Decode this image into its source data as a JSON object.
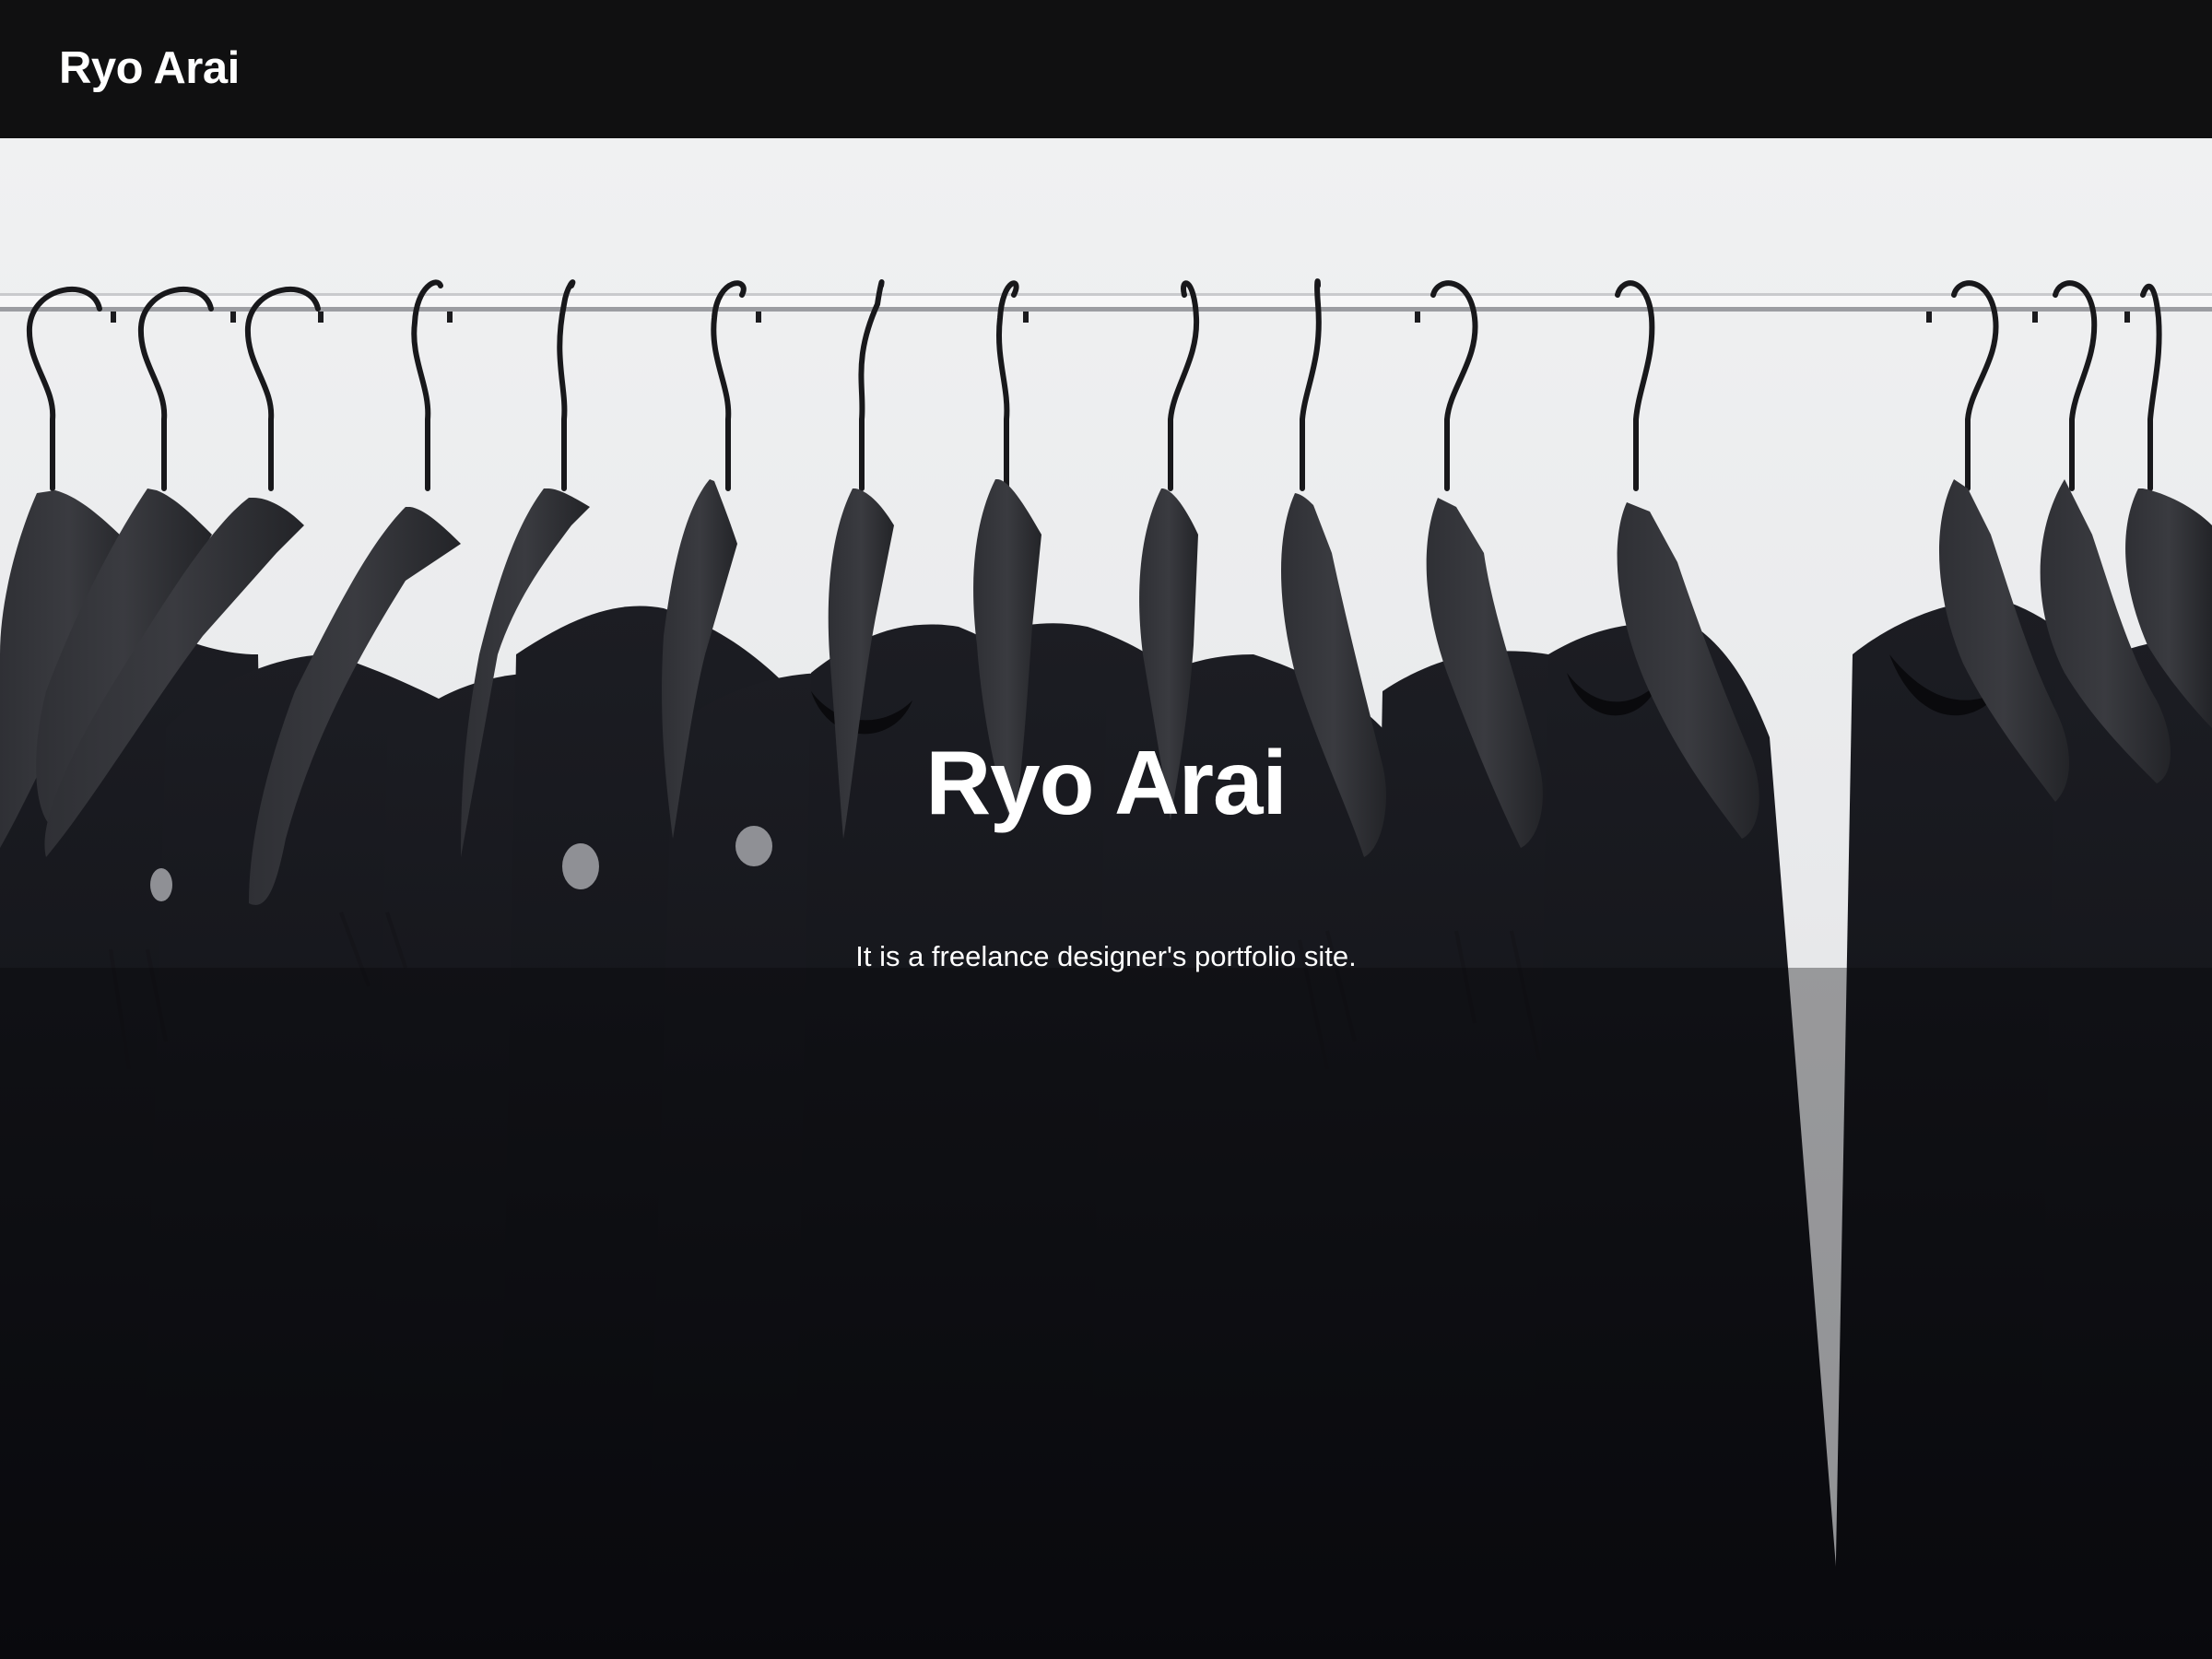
{
  "header": {
    "brand": "Ryo Arai"
  },
  "hero": {
    "title": "Ryo Arai",
    "subtitle": "It is a freelance designer's portfolio site.",
    "background_image": "clothing-rack-black-tshirts"
  },
  "colors": {
    "topbar": "#101011",
    "text": "#ffffff",
    "wall": "#eceeef",
    "garment": "#15161b",
    "hanger": "#2a2b30"
  }
}
